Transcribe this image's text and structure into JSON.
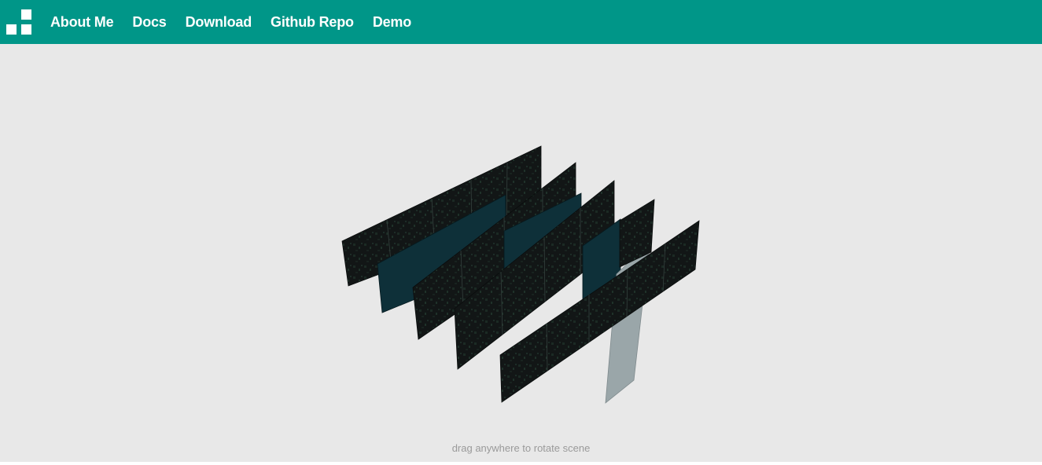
{
  "nav": {
    "logo_icon": "squares-logo-icon",
    "links": [
      {
        "label": "About Me"
      },
      {
        "label": "Docs"
      },
      {
        "label": "Download"
      },
      {
        "label": "Github Repo"
      },
      {
        "label": "Demo"
      }
    ]
  },
  "scene": {
    "hint": "drag anywhere to rotate scene"
  },
  "colors": {
    "nav_bg": "#009688",
    "page_bg": "#e8e8e8",
    "panel_dark": "#121616",
    "panel_teal": "#0e3039",
    "panel_grey": "#9aa6a9",
    "hint_text": "#9a9a9a"
  }
}
